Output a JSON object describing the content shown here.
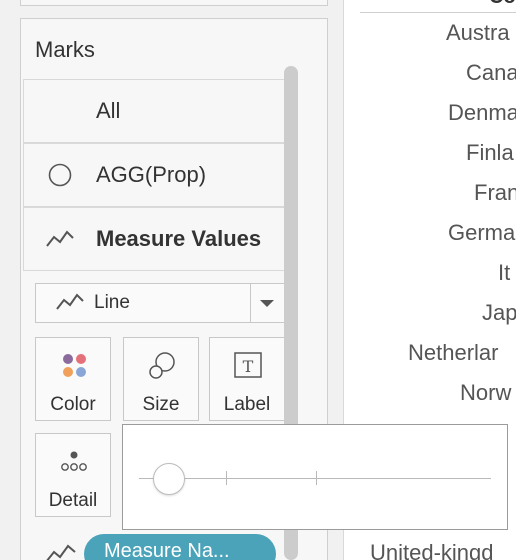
{
  "marks_card": {
    "title": "Marks",
    "rows": [
      {
        "label": "All",
        "icon": "none"
      },
      {
        "label": "AGG(Prop)",
        "icon": "circle-icon"
      },
      {
        "label": "Measure Values",
        "icon": "line-icon",
        "bold": true
      }
    ],
    "mark_type": {
      "label": "Line",
      "icon": "line-icon"
    },
    "encodings": [
      {
        "label": "Color",
        "icon": "color-dots-icon"
      },
      {
        "label": "Size",
        "icon": "size-circles-icon"
      },
      {
        "label": "Label",
        "icon": "text-label-icon"
      },
      {
        "label": "Detail",
        "icon": "detail-dots-icon"
      }
    ],
    "pill": {
      "label": "Measure Na...",
      "icon": "line-icon",
      "color": "#4aa3b9"
    }
  },
  "size_popup": {
    "slider_value": 0.0
  },
  "table": {
    "column_header": "Coun",
    "countries": [
      "Austra",
      "Cana",
      "Denma",
      "Finla",
      "Fran",
      "Germa",
      "It",
      "Jap",
      "Netherlar",
      "Norw",
      "United-kingd"
    ]
  },
  "colors": {
    "panel_bg": "#f1f1f1",
    "card_bg": "#f7f7f7",
    "pill": "#4aa3b9",
    "scrollbar": "#cccccc"
  }
}
